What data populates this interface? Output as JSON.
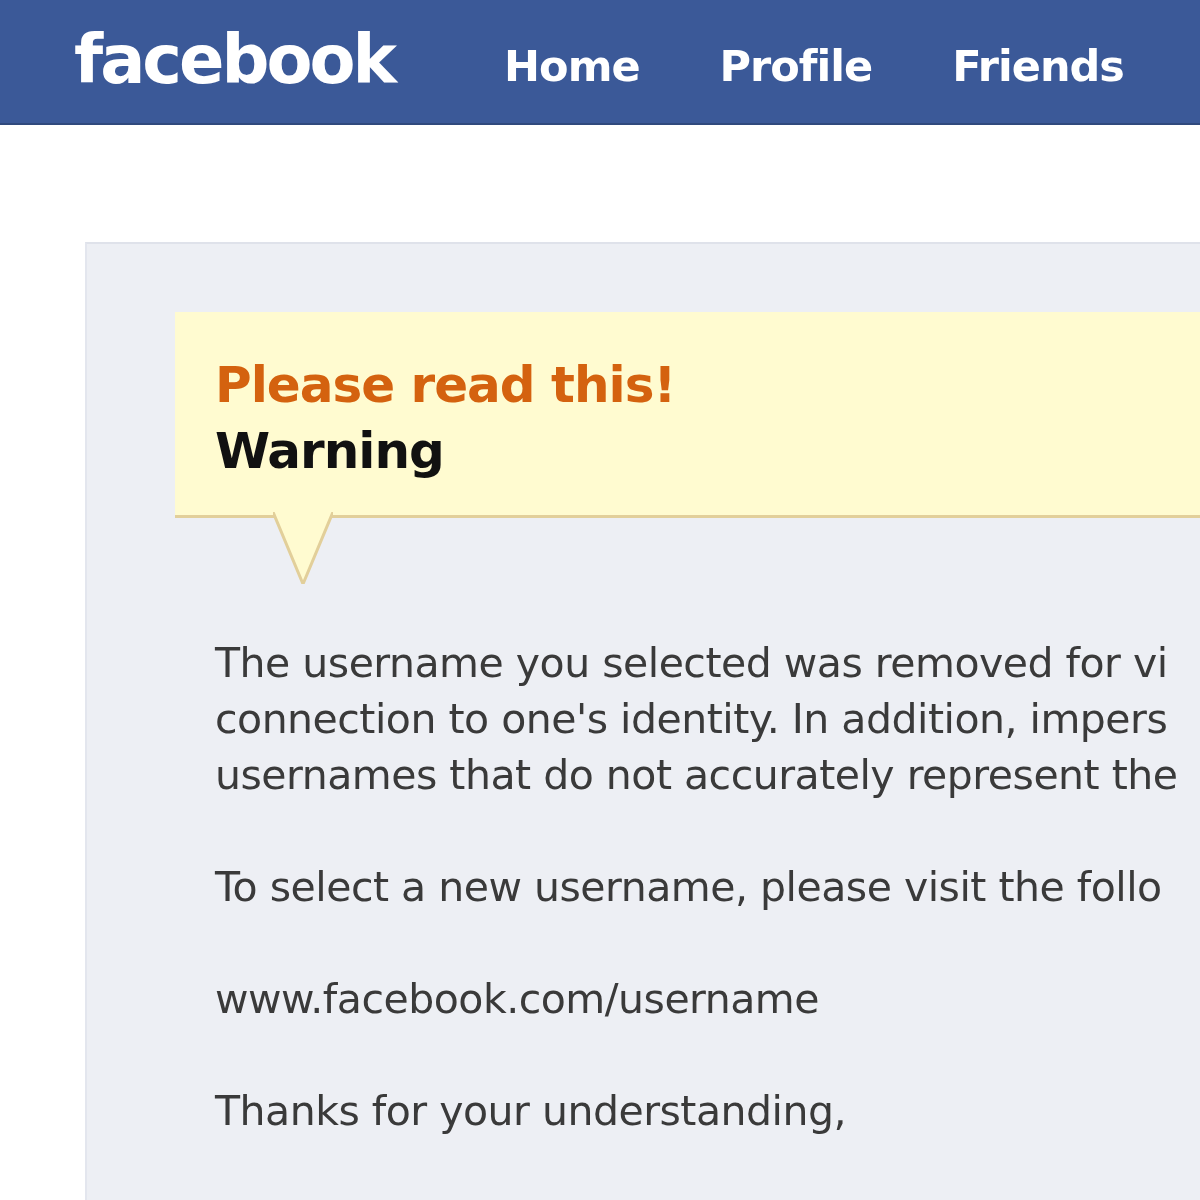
{
  "header": {
    "logo": "facebook",
    "nav": [
      {
        "label": "Home"
      },
      {
        "label": "Profile"
      },
      {
        "label": "Friends"
      }
    ]
  },
  "notice": {
    "title": "Please read this!",
    "subtitle": "Warning"
  },
  "message": {
    "paragraphs": [
      {
        "lines": [
          "The username you selected was removed for vi",
          "connection to one's identity. In addition, impers",
          "usernames that do not accurately represent the"
        ]
      },
      {
        "lines": [
          "To select a new username, please visit the follo"
        ]
      },
      {
        "lines": [
          "www.facebook.com/username"
        ]
      },
      {
        "lines": [
          "Thanks for your understanding,"
        ]
      }
    ]
  }
}
